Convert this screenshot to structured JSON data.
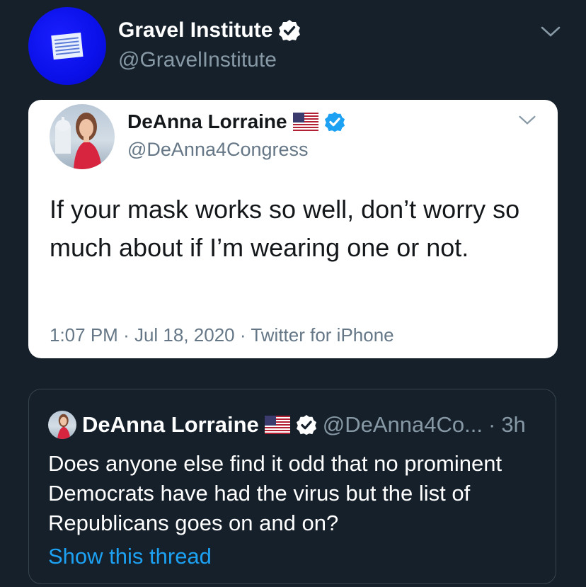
{
  "header": {
    "account_name": "Gravel Institute",
    "account_handle": "@GravelInstitute",
    "avatar_icon": "gravel-institute-logo",
    "menu_icon": "chevron-down-icon"
  },
  "embedded_tweet": {
    "author_name": "DeAnna Lorraine",
    "author_handle": "@DeAnna4Congress",
    "flag_icon": "us-flag-icon",
    "verified_icon": "verified-badge-icon",
    "text": "If your mask works so well, don’t worry so much about if I’m wearing one or not.",
    "time": "1:07 PM",
    "date": "Jul 18, 2020",
    "source": "Twitter for iPhone",
    "separator": "·"
  },
  "quoted_tweet": {
    "author_name": "DeAnna Lorraine",
    "author_handle": "@DeAnna4Co...",
    "age": "3h",
    "separator": "·",
    "text": "Does anyone else find it odd that no prominent Democrats have had the virus but the list of Republicans goes on and on?",
    "show_thread_label": "Show this thread"
  },
  "colors": {
    "background": "#15202b",
    "card": "#ffffff",
    "accent": "#1da1f2",
    "muted": "#8899a6",
    "gravel_blue": "#0a10e8"
  }
}
